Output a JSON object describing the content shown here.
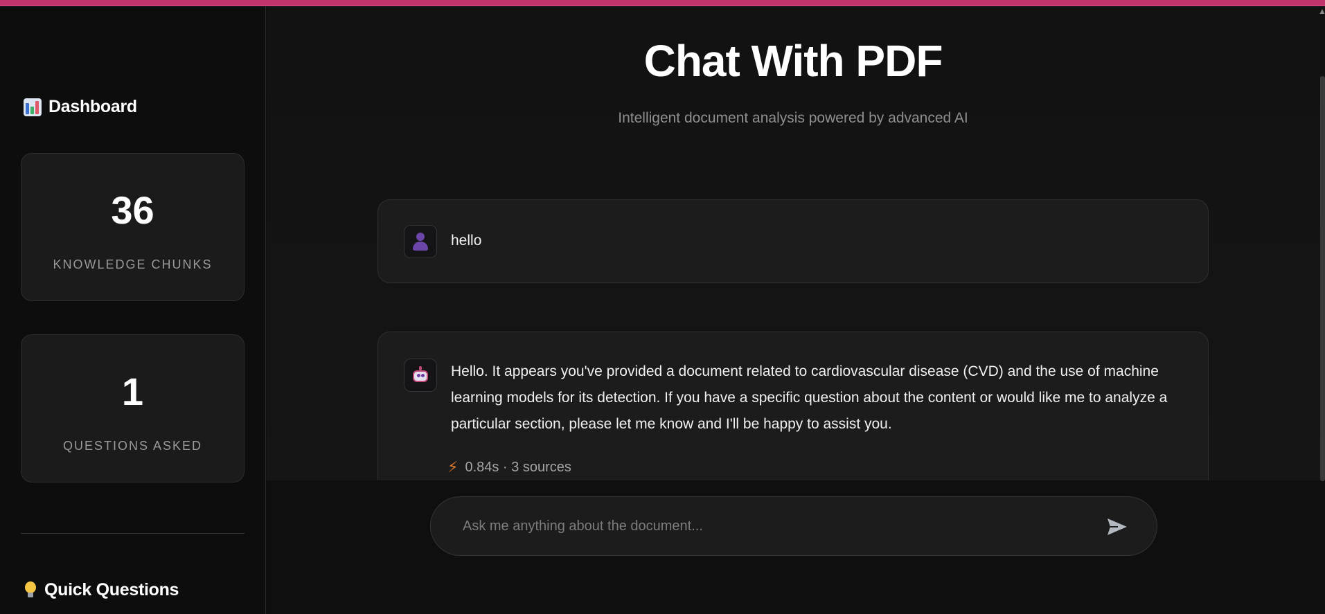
{
  "header": {
    "title": "Chat With PDF",
    "subtitle": "Intelligent document analysis powered by advanced AI",
    "accent_color": "#c0336b"
  },
  "sidebar": {
    "dashboard_title": "Dashboard",
    "dashboard_icon": "bar-chart-icon",
    "stats": [
      {
        "value": "36",
        "label": "KNOWLEDGE CHUNKS"
      },
      {
        "value": "1",
        "label": "QUESTIONS ASKED"
      }
    ],
    "quick_questions_title": "Quick Questions",
    "quick_questions_icon": "lightbulb-icon"
  },
  "chat": {
    "messages": [
      {
        "role": "user",
        "avatar_icon": "user-icon",
        "text": "hello"
      },
      {
        "role": "assistant",
        "avatar_icon": "robot-icon",
        "text": "Hello. It appears you've provided a document related to cardiovascular disease (CVD) and the use of machine learning models for its detection. If you have a specific question about the content or would like me to analyze a particular section, please let me know and I'll be happy to assist you.",
        "meta_icon": "lightning-icon",
        "meta": "0.84s · 3 sources"
      }
    ],
    "input": {
      "placeholder": "Ask me anything about the document...",
      "value": "",
      "send_icon": "send-icon"
    }
  }
}
